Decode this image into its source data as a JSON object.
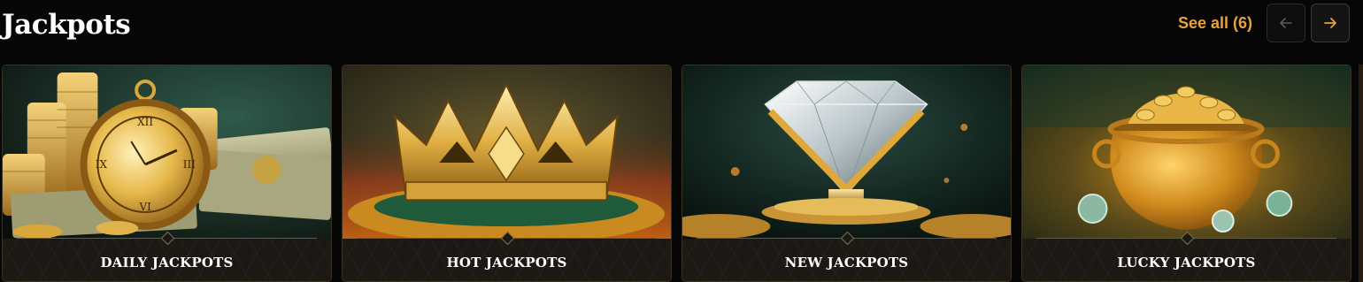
{
  "header": {
    "title": "Jackpots",
    "see_all_label": "See all (6)",
    "prev_icon": "arrow-left-icon",
    "next_icon": "arrow-right-icon"
  },
  "colors": {
    "accent": "#e8a23c",
    "background": "#060606",
    "card_footer": "#1c1915",
    "gold": "#d4a53a"
  },
  "cards": [
    {
      "label": "DAILY JACKPOTS",
      "art": "gold-pocket-watch-coins-banknotes"
    },
    {
      "label": "HOT JACKPOTS",
      "art": "gold-crown-on-fiery-cushion"
    },
    {
      "label": "NEW JACKPOTS",
      "art": "diamond-on-gold-pedestal"
    },
    {
      "label": "LUCKY JACKPOTS",
      "art": "pot-of-gold-coins"
    }
  ]
}
